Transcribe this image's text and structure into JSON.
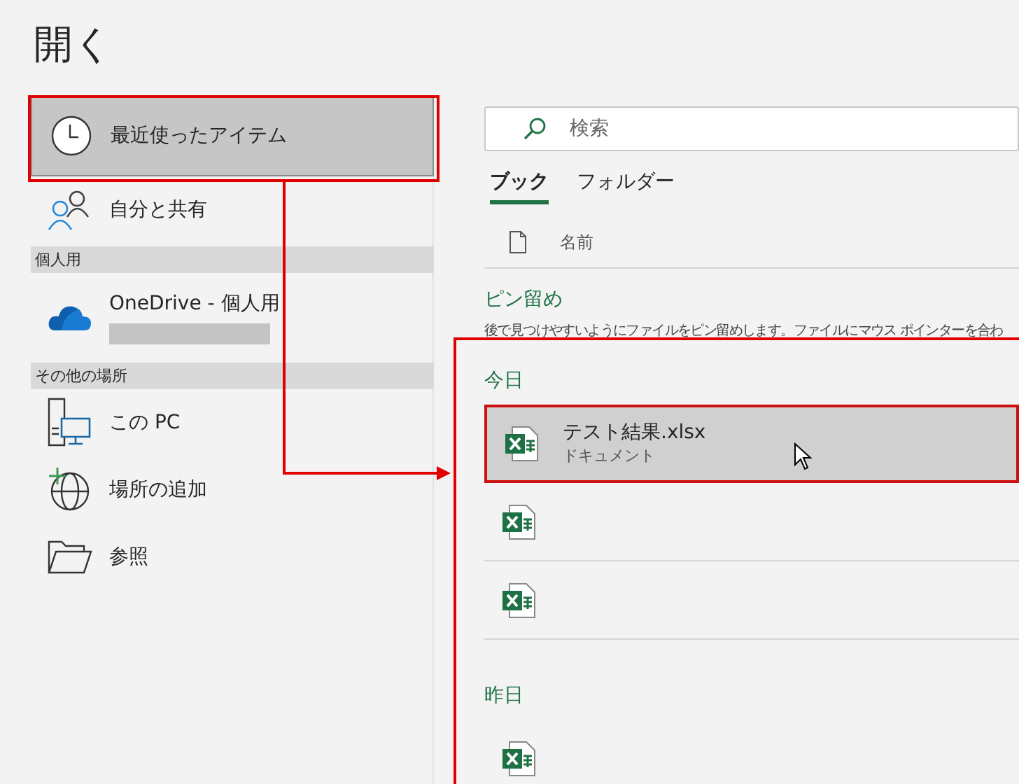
{
  "title": "開く",
  "nav": [
    {
      "kind": "item",
      "label": "最近使ったアイテム",
      "selected": true
    },
    {
      "kind": "item",
      "label": "自分と共有",
      "selected": false
    },
    {
      "kind": "header",
      "label": "個人用"
    },
    {
      "kind": "item",
      "label": "OneDrive - 個人用",
      "selected": false,
      "hidden_detail": true
    },
    {
      "kind": "header",
      "label": "その他の場所"
    },
    {
      "kind": "item",
      "label": "この PC",
      "selected": false
    },
    {
      "kind": "item",
      "label": "場所の追加",
      "selected": false
    },
    {
      "kind": "item",
      "label": "参照",
      "selected": false
    }
  ],
  "search": {
    "placeholder": "検索"
  },
  "tabs": [
    {
      "label": "ブック",
      "selected": true
    },
    {
      "label": "フォルダー",
      "selected": false
    }
  ],
  "columns": [
    {
      "label": "名前"
    }
  ],
  "pinned": {
    "heading": "ピン留め",
    "text": "後で見つけやすいようにファイルをピン留めします。ファイルにマウス ポインターを合わ"
  },
  "groups": [
    {
      "label": "今日",
      "files": [
        {
          "name": "テスト結果.xlsx",
          "type": "ドキュメント",
          "selected": true
        },
        {
          "selected": false
        },
        {
          "selected": false
        }
      ]
    },
    {
      "label": "昨日",
      "files": [
        {
          "selected": false
        }
      ]
    }
  ]
}
